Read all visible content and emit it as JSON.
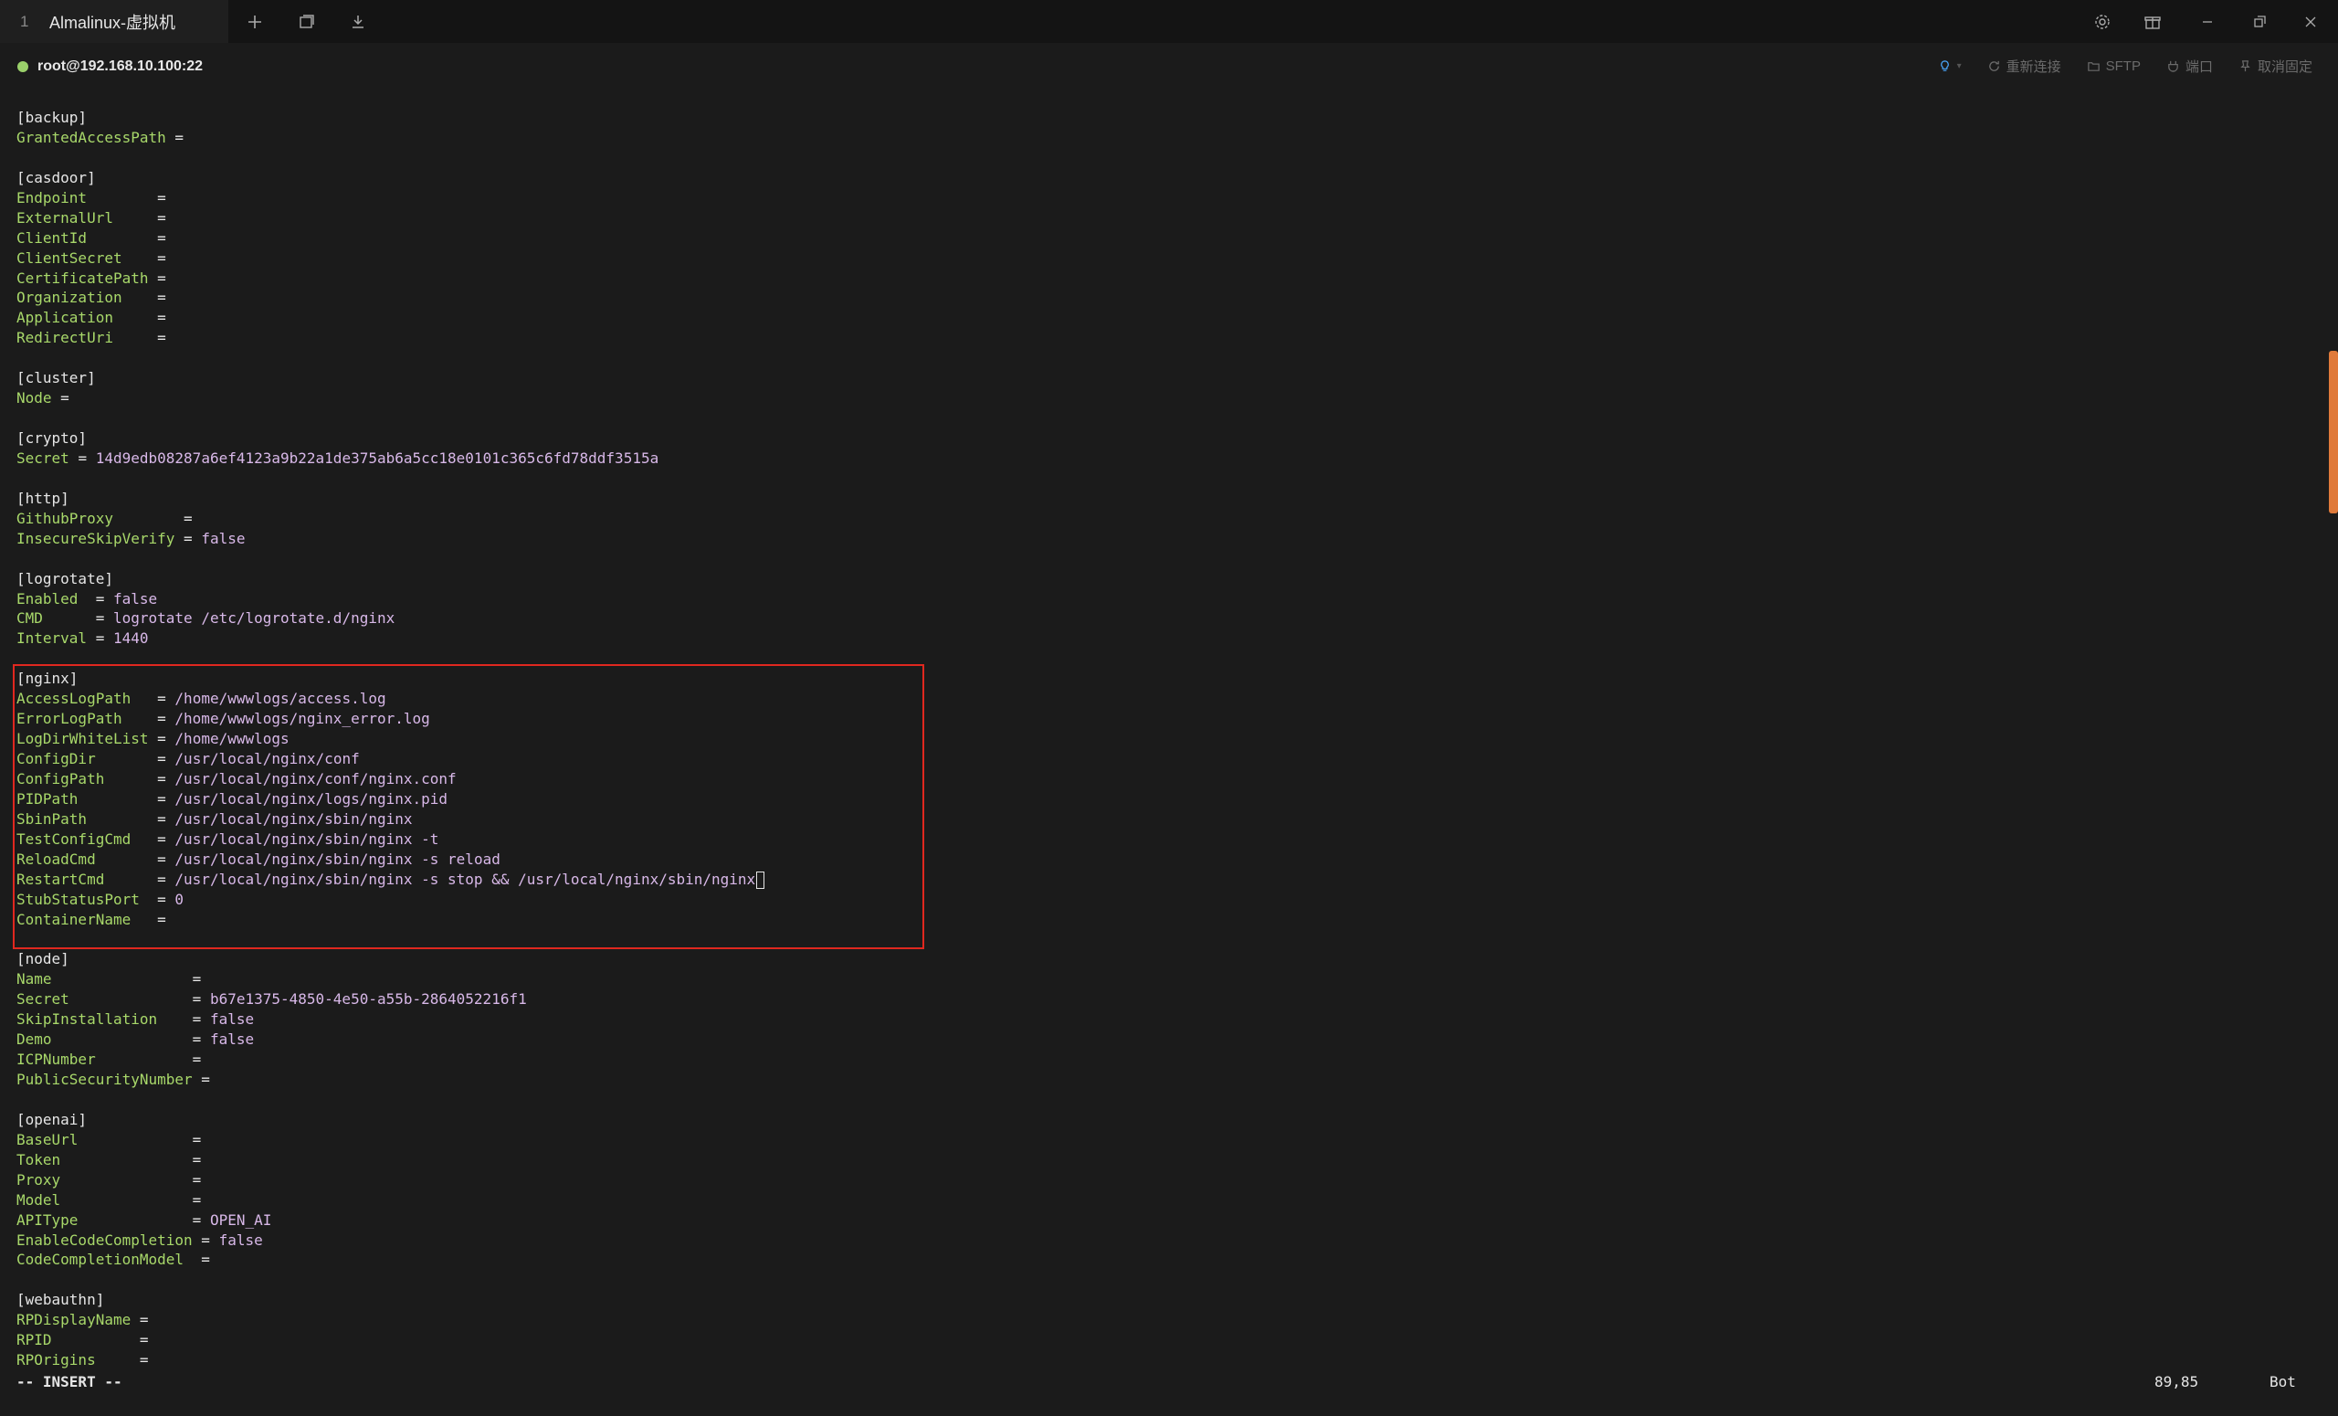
{
  "tab": {
    "number": "1",
    "title": "Almalinux-虚拟机"
  },
  "connection": {
    "host": "root@192.168.10.100:22",
    "status_color": "#9ad06a",
    "actions": [
      {
        "label": "重新连接",
        "icon": "reconnect-icon"
      },
      {
        "label": "SFTP",
        "icon": "folder-icon"
      },
      {
        "label": "端口",
        "icon": "plug-icon"
      },
      {
        "label": "取消固定",
        "icon": "pin-icon"
      }
    ]
  },
  "terminal": {
    "lines": [
      {
        "type": "section",
        "text": "[backup]"
      },
      {
        "type": "kv",
        "key": "GrantedAccessPath",
        "pad": " ",
        "value": ""
      },
      {
        "type": "blank"
      },
      {
        "type": "section",
        "text": "[casdoor]"
      },
      {
        "type": "kv",
        "key": "Endpoint",
        "pad": "        ",
        "value": ""
      },
      {
        "type": "kv",
        "key": "ExternalUrl",
        "pad": "     ",
        "value": ""
      },
      {
        "type": "kv",
        "key": "ClientId",
        "pad": "        ",
        "value": ""
      },
      {
        "type": "kv",
        "key": "ClientSecret",
        "pad": "    ",
        "value": ""
      },
      {
        "type": "kv",
        "key": "CertificatePath",
        "pad": " ",
        "value": ""
      },
      {
        "type": "kv",
        "key": "Organization",
        "pad": "    ",
        "value": ""
      },
      {
        "type": "kv",
        "key": "Application",
        "pad": "     ",
        "value": ""
      },
      {
        "type": "kv",
        "key": "RedirectUri",
        "pad": "     ",
        "value": ""
      },
      {
        "type": "blank"
      },
      {
        "type": "section",
        "text": "[cluster]"
      },
      {
        "type": "kv",
        "key": "Node",
        "pad": " ",
        "value": ""
      },
      {
        "type": "blank"
      },
      {
        "type": "section",
        "text": "[crypto]"
      },
      {
        "type": "kv",
        "key": "Secret",
        "pad": " ",
        "value": "14d9edb08287a6ef4123a9b22a1de375ab6a5cc18e0101c365c6fd78ddf3515a"
      },
      {
        "type": "blank"
      },
      {
        "type": "section",
        "text": "[http]"
      },
      {
        "type": "kv",
        "key": "GithubProxy",
        "pad": "        ",
        "value": ""
      },
      {
        "type": "kv",
        "key": "InsecureSkipVerify",
        "pad": " ",
        "value": "false"
      },
      {
        "type": "blank"
      },
      {
        "type": "section",
        "text": "[logrotate]"
      },
      {
        "type": "kv",
        "key": "Enabled",
        "pad": "  ",
        "value": "false"
      },
      {
        "type": "kv",
        "key": "CMD",
        "pad": "      ",
        "value": "logrotate /etc/logrotate.d/nginx"
      },
      {
        "type": "kv",
        "key": "Interval",
        "pad": " ",
        "value": "1440"
      },
      {
        "type": "blank"
      },
      {
        "type": "section",
        "text": "[nginx]"
      },
      {
        "type": "kv",
        "key": "AccessLogPath",
        "pad": "   ",
        "value": "/home/wwwlogs/access.log"
      },
      {
        "type": "kv",
        "key": "ErrorLogPath",
        "pad": "    ",
        "value": "/home/wwwlogs/nginx_error.log"
      },
      {
        "type": "kv",
        "key": "LogDirWhiteList",
        "pad": " ",
        "value": "/home/wwwlogs"
      },
      {
        "type": "kv",
        "key": "ConfigDir",
        "pad": "       ",
        "value": "/usr/local/nginx/conf"
      },
      {
        "type": "kv",
        "key": "ConfigPath",
        "pad": "      ",
        "value": "/usr/local/nginx/conf/nginx.conf"
      },
      {
        "type": "kv",
        "key": "PIDPath",
        "pad": "         ",
        "value": "/usr/local/nginx/logs/nginx.pid"
      },
      {
        "type": "kv",
        "key": "SbinPath",
        "pad": "        ",
        "value": "/usr/local/nginx/sbin/nginx"
      },
      {
        "type": "kv",
        "key": "TestConfigCmd",
        "pad": "   ",
        "value": "/usr/local/nginx/sbin/nginx -t"
      },
      {
        "type": "kv",
        "key": "ReloadCmd",
        "pad": "       ",
        "value": "/usr/local/nginx/sbin/nginx -s reload"
      },
      {
        "type": "kv",
        "key": "RestartCmd",
        "pad": "      ",
        "value": "/usr/local/nginx/sbin/nginx -s stop && /usr/local/nginx/sbin/nginx",
        "cursor": true
      },
      {
        "type": "kv",
        "key": "StubStatusPort",
        "pad": "  ",
        "value": "0"
      },
      {
        "type": "kv",
        "key": "ContainerName",
        "pad": "   ",
        "value": ""
      },
      {
        "type": "blank"
      },
      {
        "type": "section",
        "text": "[node]"
      },
      {
        "type": "kv",
        "key": "Name",
        "pad": "                ",
        "value": ""
      },
      {
        "type": "kv",
        "key": "Secret",
        "pad": "              ",
        "value": "b67e1375-4850-4e50-a55b-2864052216f1"
      },
      {
        "type": "kv",
        "key": "SkipInstallation",
        "pad": "    ",
        "value": "false"
      },
      {
        "type": "kv",
        "key": "Demo",
        "pad": "                ",
        "value": "false"
      },
      {
        "type": "kv",
        "key": "ICPNumber",
        "pad": "           ",
        "value": ""
      },
      {
        "type": "kv",
        "key": "PublicSecurityNumber",
        "pad": " ",
        "value": ""
      },
      {
        "type": "blank"
      },
      {
        "type": "section",
        "text": "[openai]"
      },
      {
        "type": "kv",
        "key": "BaseUrl",
        "pad": "             ",
        "value": ""
      },
      {
        "type": "kv",
        "key": "Token",
        "pad": "               ",
        "value": ""
      },
      {
        "type": "kv",
        "key": "Proxy",
        "pad": "               ",
        "value": ""
      },
      {
        "type": "kv",
        "key": "Model",
        "pad": "               ",
        "value": ""
      },
      {
        "type": "kv",
        "key": "APIType",
        "pad": "             ",
        "value": "OPEN_AI"
      },
      {
        "type": "kv",
        "key": "EnableCodeCompletion",
        "pad": " ",
        "value": "false"
      },
      {
        "type": "kv",
        "key": "CodeCompletionModel",
        "pad": "  ",
        "value": ""
      },
      {
        "type": "blank"
      },
      {
        "type": "section",
        "text": "[webauthn]"
      },
      {
        "type": "kv",
        "key": "RPDisplayName",
        "pad": " ",
        "value": ""
      },
      {
        "type": "kv",
        "key": "RPID",
        "pad": "          ",
        "value": ""
      },
      {
        "type": "kv",
        "key": "RPOrigins",
        "pad": "     ",
        "value": ""
      }
    ]
  },
  "status": {
    "mode": "-- INSERT --",
    "position": "89,85",
    "scroll": "Bot"
  },
  "colors": {
    "key": "#a8d86a",
    "value": "#d8b8e8",
    "highlight": "#e0281f",
    "scrollbar": "#e07a3a"
  }
}
